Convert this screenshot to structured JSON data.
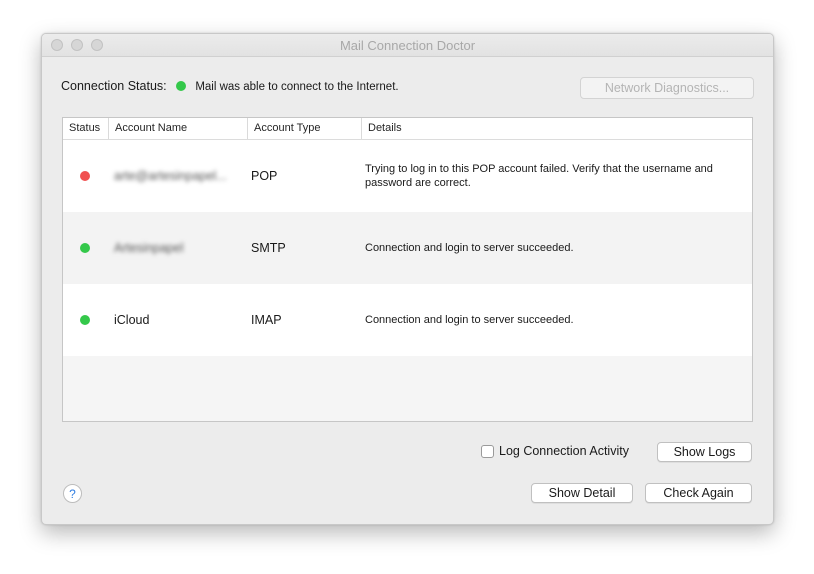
{
  "window": {
    "title": "Mail Connection Doctor"
  },
  "status": {
    "label": "Connection Status:",
    "indicator": "green",
    "message": "Mail was able to connect to the Internet."
  },
  "toolbar": {
    "network_diagnostics": "Network Diagnostics..."
  },
  "table": {
    "headers": [
      "Status",
      "Account Name",
      "Account Type",
      "Details"
    ],
    "rows": [
      {
        "status": "red",
        "name": "arte@artesinpapel...",
        "name_blurred": true,
        "type": "POP",
        "details": "Trying to log in to this POP account failed. Verify that the username and password are correct."
      },
      {
        "status": "green",
        "name": "Artesinpapel",
        "name_blurred": true,
        "type": "SMTP",
        "details": "Connection and login to server succeeded."
      },
      {
        "status": "green",
        "name": "iCloud",
        "name_blurred": false,
        "type": "IMAP",
        "details": "Connection and login to server succeeded."
      }
    ]
  },
  "options": {
    "log_activity_label": "Log Connection Activity",
    "log_activity_checked": false,
    "show_logs": "Show Logs"
  },
  "footer": {
    "help": "?",
    "show_detail": "Show Detail",
    "check_again": "Check Again"
  },
  "colors": {
    "green": "#34c84a",
    "red": "#f05050"
  }
}
